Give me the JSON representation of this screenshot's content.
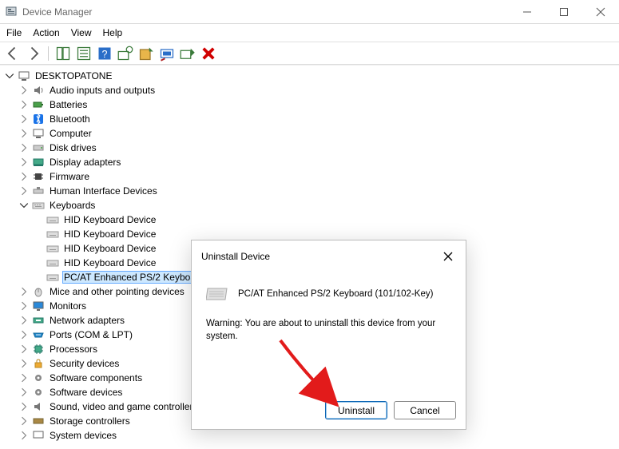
{
  "window": {
    "title": "Device Manager"
  },
  "menubar": {
    "file": "File",
    "action": "Action",
    "view": "View",
    "help": "Help"
  },
  "tree": {
    "root": "DESKTOPATONE",
    "audio": "Audio inputs and outputs",
    "batteries": "Batteries",
    "bluetooth": "Bluetooth",
    "computer": "Computer",
    "disk": "Disk drives",
    "display": "Display adapters",
    "firmware": "Firmware",
    "hid": "Human Interface Devices",
    "keyboards": "Keyboards",
    "kb_hid": "HID Keyboard Device",
    "kb_psat": "PC/AT Enhanced PS/2 Keyboard",
    "mice": "Mice and other pointing devices",
    "monitors": "Monitors",
    "network": "Network adapters",
    "ports": "Ports (COM & LPT)",
    "processors": "Processors",
    "security": "Security devices",
    "swcomp": "Software components",
    "swdev": "Software devices",
    "sound": "Sound, video and game controllers",
    "storage": "Storage controllers",
    "system": "System devices"
  },
  "dialog": {
    "title": "Uninstall Device",
    "device": "PC/AT Enhanced PS/2 Keyboard (101/102-Key)",
    "warning": "Warning: You are about to uninstall this device from your system.",
    "uninstall": "Uninstall",
    "cancel": "Cancel"
  }
}
